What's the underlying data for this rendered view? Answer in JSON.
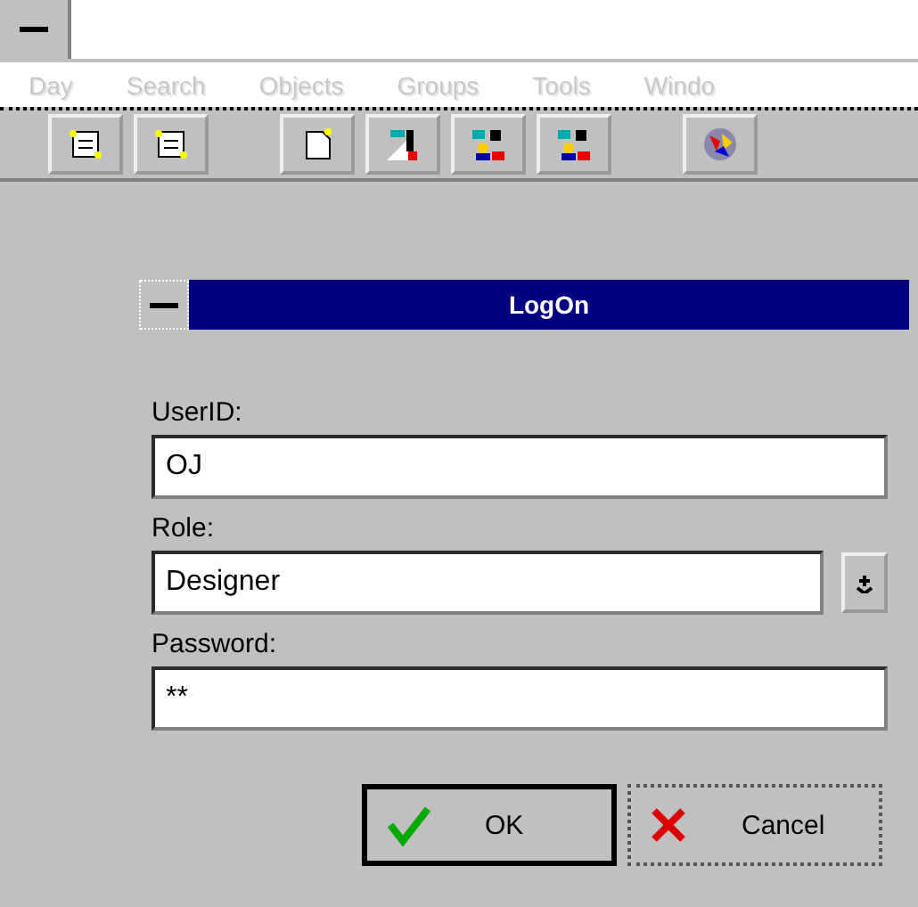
{
  "menu": [
    {
      "label": "Day",
      "disabled": true
    },
    {
      "label": "Search",
      "disabled": true
    },
    {
      "label": "Objects",
      "disabled": true
    },
    {
      "label": "Groups",
      "disabled": true
    },
    {
      "label": "Tools",
      "disabled": true
    },
    {
      "label": "Windo",
      "disabled": true
    }
  ],
  "toolbar": [
    {
      "kind": "sheet"
    },
    {
      "kind": "sheet"
    },
    {
      "kind": "gap"
    },
    {
      "kind": "page"
    },
    {
      "kind": "chart"
    },
    {
      "kind": "people"
    },
    {
      "kind": "people"
    },
    {
      "kind": "gap"
    },
    {
      "kind": "globe"
    }
  ],
  "dialog": {
    "title": "LogOn",
    "fields": [
      {
        "kind": "text",
        "label": "UserID:",
        "value": "OJ"
      },
      {
        "kind": "combo",
        "label": "Role:",
        "value": "Designer"
      },
      {
        "kind": "text",
        "label": "Password:",
        "value": "**"
      }
    ],
    "buttons": [
      {
        "kind": "ok",
        "label": "OK",
        "default": true
      },
      {
        "kind": "cancel",
        "label": "Cancel",
        "default": false
      }
    ]
  }
}
